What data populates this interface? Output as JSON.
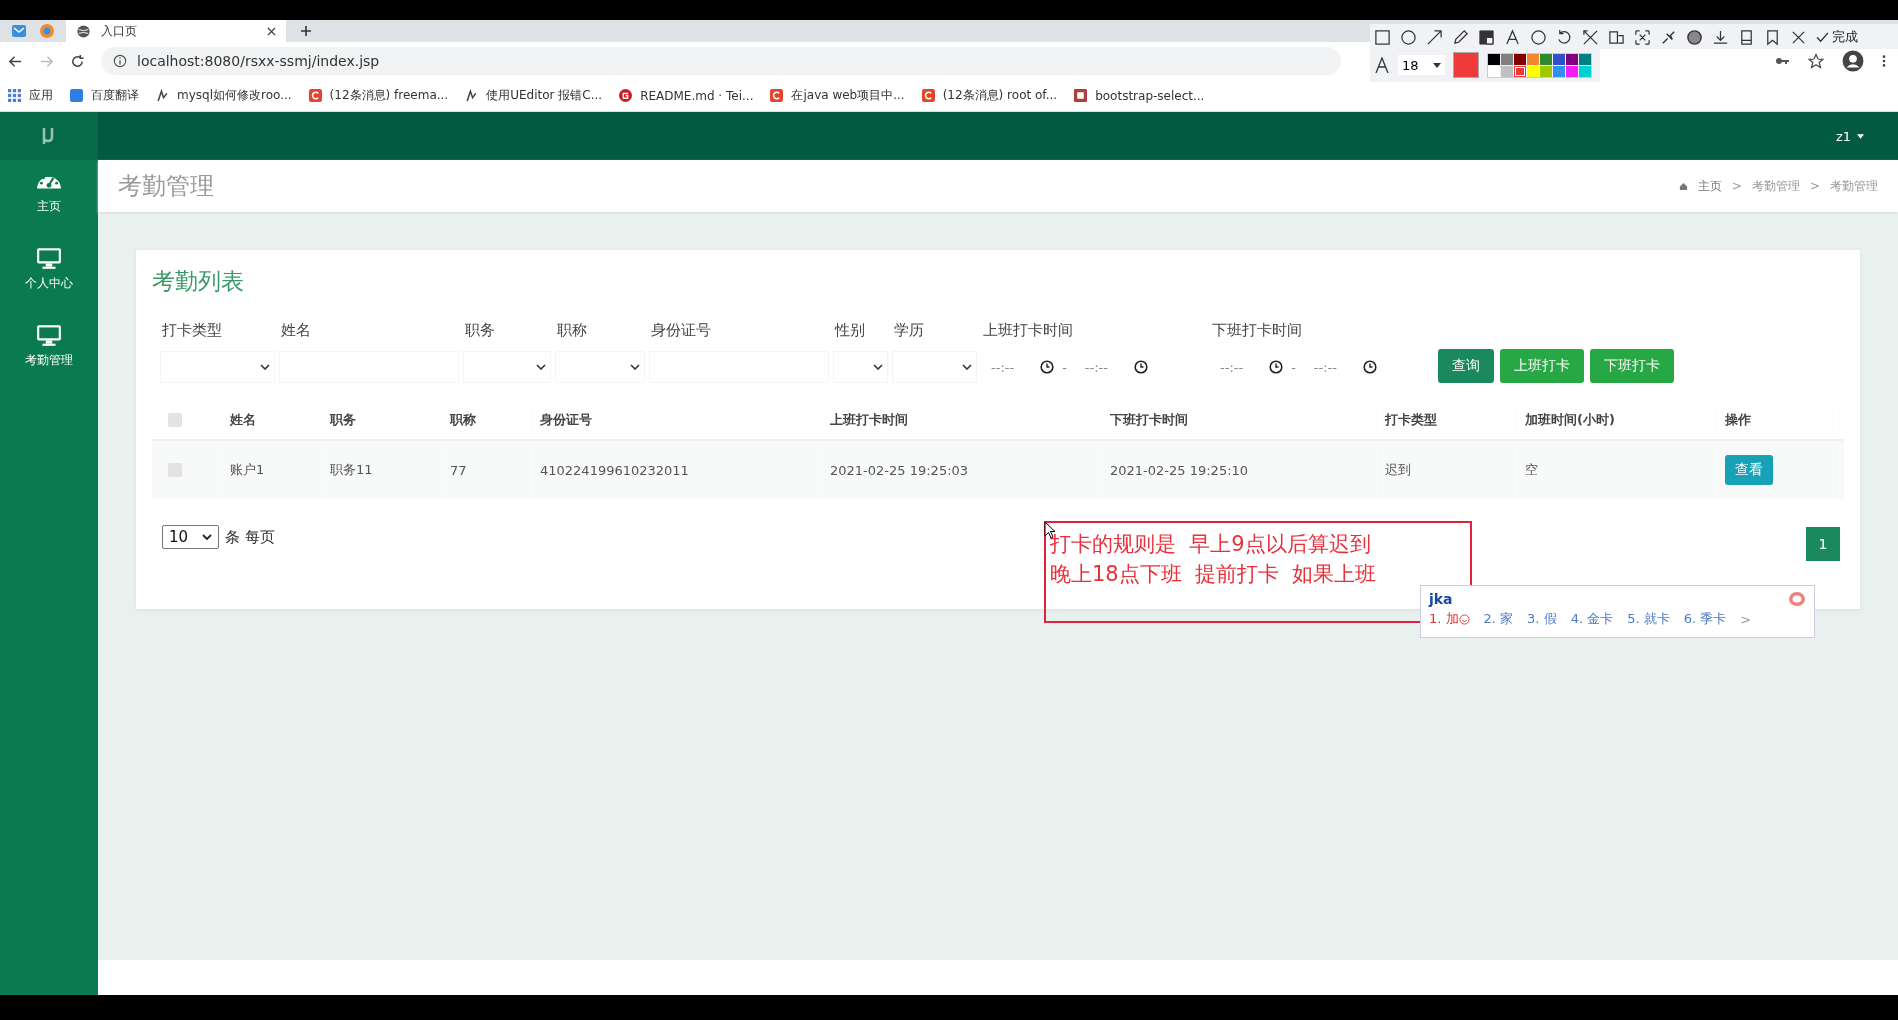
{
  "browser": {
    "tab_title": "入口页",
    "url": "localhost:8080/rsxx-ssmj/index.jsp",
    "bookmarks": [
      {
        "label": "应用",
        "kind": "apps"
      },
      {
        "label": "百度翻译",
        "kind": "blue"
      },
      {
        "label": "mysql如何修改roo...",
        "kind": "paw"
      },
      {
        "label": "(12条消息) freema...",
        "kind": "red"
      },
      {
        "label": "使用UEditor 报错C...",
        "kind": "paw"
      },
      {
        "label": "README.md · Tei...",
        "kind": "gitee"
      },
      {
        "label": "在java web项目中...",
        "kind": "red"
      },
      {
        "label": "(12条消息) root of...",
        "kind": "red"
      },
      {
        "label": "bootstrap-select...",
        "kind": "doc"
      }
    ]
  },
  "snip_toolbar": {
    "done_label": "完成",
    "font_size": "18",
    "palette": [
      {
        "color": "#000000"
      },
      {
        "color": "#808080"
      },
      {
        "color": "#800000"
      },
      {
        "color": "#f08a30"
      },
      {
        "color": "#2f8a2f"
      },
      {
        "color": "#3050c8"
      },
      {
        "color": "#800080"
      },
      {
        "color": "#008080"
      },
      {
        "color": "#ffffff"
      },
      {
        "color": "#c0c0c0"
      },
      {
        "color": "#f03a3a",
        "selected": true
      },
      {
        "color": "#ffff00"
      },
      {
        "color": "#a0c800"
      },
      {
        "color": "#3090f0"
      },
      {
        "color": "#f020f0"
      },
      {
        "color": "#00d0d0"
      }
    ]
  },
  "app": {
    "user_menu": "z1",
    "sidebar": {
      "items": [
        {
          "label": "主页",
          "kind": "dashboard"
        },
        {
          "label": "个人中心",
          "kind": "monitor"
        },
        {
          "label": "考勤管理",
          "kind": "monitor"
        }
      ]
    },
    "page_title": "考勤管理",
    "breadcrumb": {
      "separator": ">",
      "items": [
        "主页",
        "考勤管理",
        "考勤管理"
      ]
    },
    "card_title": "考勤列表",
    "filters": [
      {
        "label": "打卡类型",
        "kind": "select"
      },
      {
        "label": "姓名",
        "kind": "text"
      },
      {
        "label": "职务",
        "kind": "select"
      },
      {
        "label": "职称",
        "kind": "select"
      },
      {
        "label": "身份证号",
        "kind": "text"
      },
      {
        "label": "性别",
        "kind": "select"
      },
      {
        "label": "学历",
        "kind": "select"
      },
      {
        "label": "上班打卡时间",
        "kind": "timerange",
        "from_placeholder": "--:--",
        "separator": "-",
        "to_placeholder": "--:--"
      },
      {
        "label": "下班打卡时间",
        "kind": "timerange",
        "from_placeholder": "--:--",
        "separator": "-",
        "to_placeholder": "--:--"
      }
    ],
    "buttons": [
      {
        "label": "查询",
        "kind": "primary"
      },
      {
        "label": "上班打卡",
        "kind": "success"
      },
      {
        "label": "下班打卡",
        "kind": "success"
      }
    ],
    "table": {
      "header_checked": false,
      "columns": [
        "姓名",
        "职务",
        "职称",
        "身份证号",
        "上班打卡时间",
        "下班打卡时间",
        "打卡类型",
        "加班时间(小时)",
        "操作"
      ],
      "rows": [
        {
          "checked": false,
          "cells": [
            "账户1",
            "职务11",
            "77",
            "410224199610232011",
            "2021-02-25 19:25:03",
            "2021-02-25 19:25:10",
            "迟到",
            "空"
          ],
          "action": "查看"
        }
      ]
    },
    "page_size": "10",
    "page_size_label": "条 每页",
    "pages": [
      {
        "label": "1",
        "selected": true
      }
    ]
  },
  "annotation": {
    "lines": [
      "打卡的规则是  早上9点以后算迟到",
      "晚上18点下班  提前打卡  如果上班"
    ]
  },
  "ime": {
    "input": "jka",
    "candidates": [
      "1. 加",
      "2. 家",
      "3. 假",
      "4. 金卡",
      "5. 就卡",
      "6. 季卡"
    ],
    "more": ">"
  }
}
